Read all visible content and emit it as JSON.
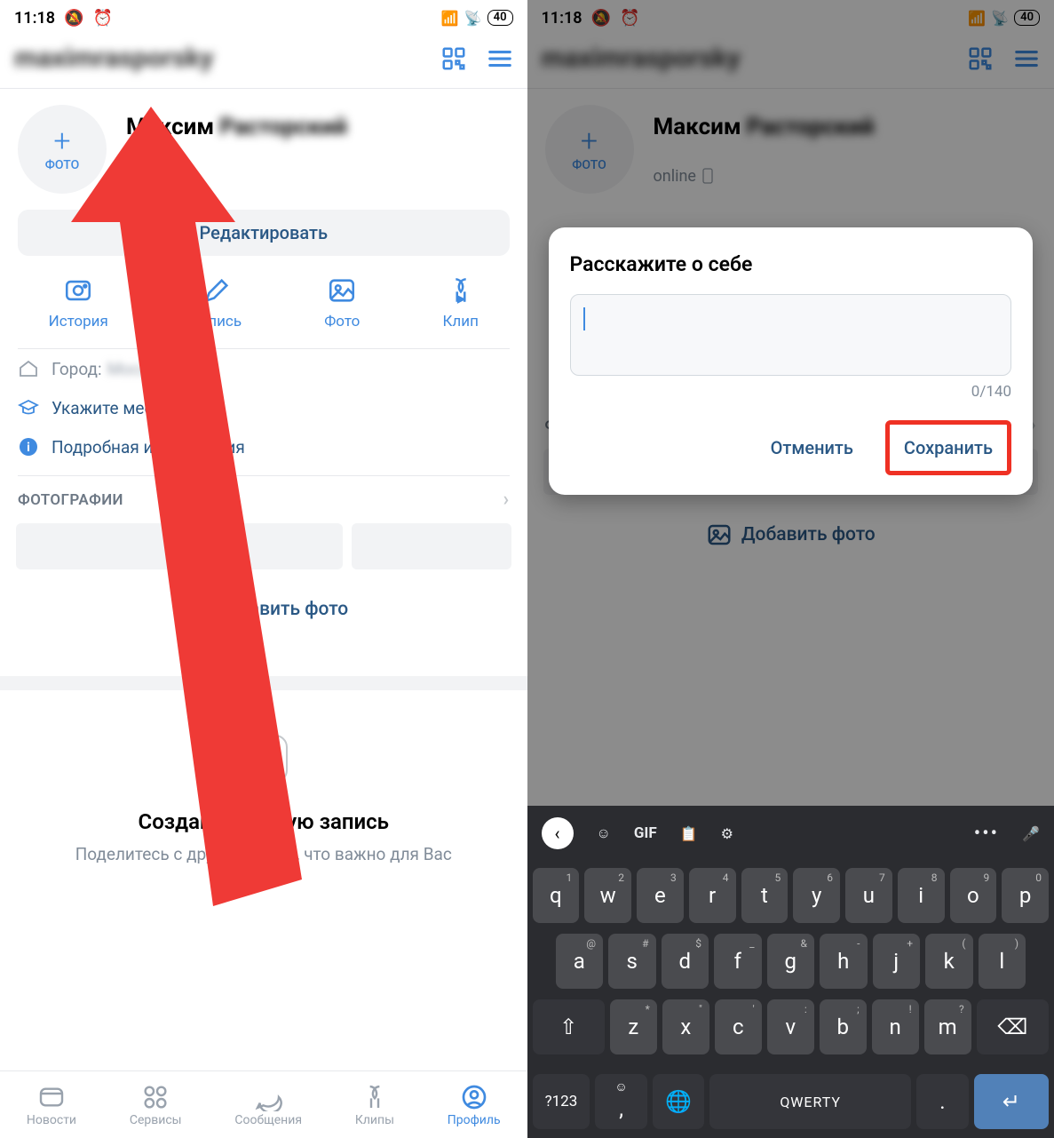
{
  "status": {
    "time": "11:18",
    "battery": "40"
  },
  "username_blurred": "maximrasporsky",
  "profile": {
    "first_name": "Максим",
    "last_name_blurred": "Расторский",
    "photo_plus": "+",
    "photo_label": "ФОТО",
    "status_text": "online"
  },
  "edit_label": "Редактировать",
  "actions": {
    "story": "История",
    "post": "Запись",
    "photo": "Фото",
    "clip": "Клип"
  },
  "info": {
    "city_label": "Город:",
    "study": "Укажите место учёбы",
    "details": "Подробная информация"
  },
  "photos_section": "ФОТОГРАФИИ",
  "add_photo": "Добавить фото",
  "create_post": {
    "title": "Создайте первую запись",
    "subtitle": "Поделитесь с друзьями тем, что важно для Вас"
  },
  "tabs": {
    "news": "Новости",
    "services": "Сервисы",
    "messages": "Сообщения",
    "clips": "Клипы",
    "profile": "Профиль"
  },
  "dialog": {
    "title": "Расскажите о себе",
    "counter": "0/140",
    "cancel": "Отменить",
    "save": "Сохранить"
  },
  "keyboard": {
    "gif": "GIF",
    "row1": [
      {
        "k": "q",
        "s": "1"
      },
      {
        "k": "w",
        "s": "2"
      },
      {
        "k": "e",
        "s": "3"
      },
      {
        "k": "r",
        "s": "4"
      },
      {
        "k": "t",
        "s": "5"
      },
      {
        "k": "y",
        "s": "6"
      },
      {
        "k": "u",
        "s": "7"
      },
      {
        "k": "i",
        "s": "8"
      },
      {
        "k": "o",
        "s": "9"
      },
      {
        "k": "p",
        "s": "0"
      }
    ],
    "row2": [
      {
        "k": "a",
        "s": "@"
      },
      {
        "k": "s",
        "s": "#"
      },
      {
        "k": "d",
        "s": "$"
      },
      {
        "k": "f",
        "s": "_"
      },
      {
        "k": "g",
        "s": "&"
      },
      {
        "k": "h",
        "s": "-"
      },
      {
        "k": "j",
        "s": "+"
      },
      {
        "k": "k",
        "s": "("
      },
      {
        "k": "l",
        "s": ")"
      }
    ],
    "row3": [
      {
        "k": "z",
        "s": "*"
      },
      {
        "k": "x",
        "s": "\""
      },
      {
        "k": "c",
        "s": "'"
      },
      {
        "k": "v",
        "s": ":"
      },
      {
        "k": "b",
        "s": ";"
      },
      {
        "k": "n",
        "s": "!"
      },
      {
        "k": "m",
        "s": "?"
      }
    ],
    "sym": "?123",
    "comma": ",",
    "space": "QWERTY",
    "dot": "."
  }
}
